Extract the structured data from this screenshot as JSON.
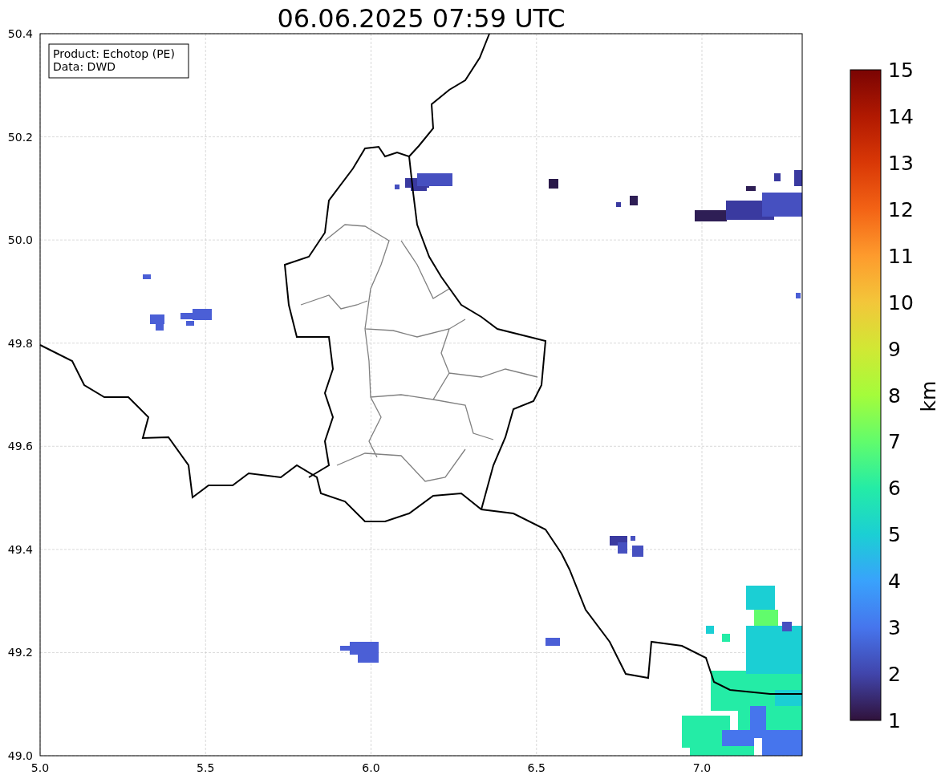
{
  "title": "06.06.2025 07:59 UTC",
  "info_box": [
    "Product: Echotop (PE)",
    "Data: DWD"
  ],
  "map": {
    "xticks": [
      "5.0",
      "5.5",
      "6.0",
      "6.5",
      "7.0"
    ],
    "yticks": [
      "50.4",
      "50.2",
      "50.0",
      "49.8",
      "49.6",
      "49.4",
      "49.2",
      "49.0"
    ]
  },
  "colorbar": {
    "label": "km",
    "ticks": [
      "15",
      "14",
      "13",
      "12",
      "11",
      "10",
      "9",
      "8",
      "7",
      "6",
      "5",
      "4",
      "3",
      "2",
      "1"
    ]
  }
}
